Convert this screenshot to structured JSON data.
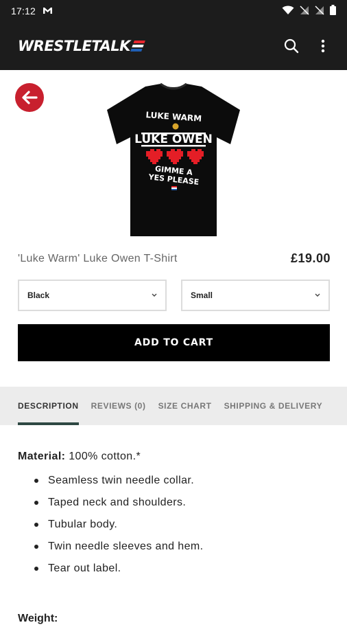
{
  "status_bar": {
    "time": "17:12",
    "notification_icon": "gmail-icon",
    "icons": [
      "wifi-icon",
      "signal-icon",
      "signal-icon",
      "battery-icon"
    ]
  },
  "app_bar": {
    "logo": "WRESTLETALK",
    "logo_flag_colors": [
      "#e8262e",
      "#ffffff",
      "#1f5fb5"
    ],
    "actions": [
      "search-icon",
      "overflow-menu-icon"
    ]
  },
  "product": {
    "image": {
      "shirt_color": "#0c0c0c",
      "text_lines": [
        "LUKE WARM",
        "LUKE OWEN",
        "GIMME A",
        "YES PLEASE"
      ],
      "heart_color": "#e41e26"
    },
    "title": "'Luke Warm' Luke Owen T-Shirt",
    "price": "£19.00",
    "color_select": {
      "value": "Black"
    },
    "size_select": {
      "value": "Small"
    },
    "add_to_cart": "ADD TO CART"
  },
  "tabs": [
    {
      "label": "DESCRIPTION",
      "active": true
    },
    {
      "label": "REVIEWS (0)",
      "active": false
    },
    {
      "label": "SIZE CHART",
      "active": false
    },
    {
      "label": "SHIPPING & DELIVERY",
      "active": false
    }
  ],
  "description": {
    "material_label": "Material:",
    "material_value": " 100% cotton.*",
    "features": [
      "Seamless twin needle collar.",
      "Taped neck and shoulders.",
      "Tubular body.",
      "Twin needle sleeves and hem.",
      "Tear out label."
    ],
    "weight_label": "Weight:"
  },
  "colors": {
    "brand_red": "#c8202e",
    "bar_dark": "#1c1c1c",
    "tab_underline": "#2e4843",
    "tab_bg": "#ececec"
  }
}
